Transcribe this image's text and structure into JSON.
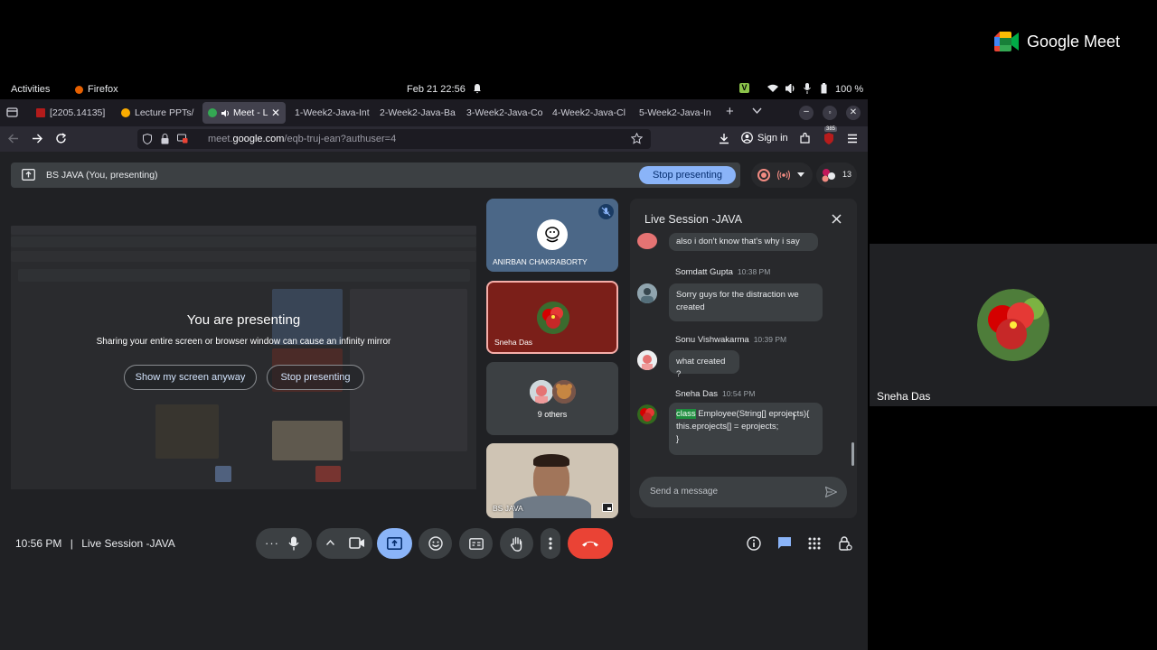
{
  "gnome": {
    "activities": "Activities",
    "app": "Firefox",
    "clock": "Feb 21  22:56",
    "battery": "100 %"
  },
  "tabs": [
    {
      "label": "[2205.14135]",
      "favicon_color": "#b31b1b"
    },
    {
      "label": "Lecture PPTs/",
      "favicon_color": "#f9ab00"
    },
    {
      "label": "Meet - L",
      "favicon_color": "#34a853",
      "active": true
    },
    {
      "label": "1-Week2-Java-Int",
      "favicon_color": ""
    },
    {
      "label": "2-Week2-Java-Ba",
      "favicon_color": ""
    },
    {
      "label": "3-Week2-Java-Co",
      "favicon_color": ""
    },
    {
      "label": "4-Week2-Java-Cl",
      "favicon_color": ""
    },
    {
      "label": "5-Week2-Java-In",
      "favicon_color": ""
    }
  ],
  "browser": {
    "url_prefix": "meet.",
    "url_domain": "google.com",
    "url_path": "/eqb-truj-ean?authuser=4",
    "signin": "Sign in",
    "badge": "385"
  },
  "meet": {
    "present_title": "BS JAVA (You, presenting)",
    "stop_presenting_top": "Stop presenting",
    "participant_count": "13",
    "presenting_heading": "You are presenting",
    "presenting_warning": "Sharing your entire screen or browser window can cause an infinity mirror",
    "show_anyway": "Show my screen anyway",
    "stop_presenting": "Stop presenting",
    "time": "10:56 PM",
    "separator": "|",
    "meeting_name": "Live Session -JAVA"
  },
  "tiles": [
    {
      "name": "ANIRBAN CHAKRABORTY",
      "bg": "#4b6787"
    },
    {
      "name": "Sneha Das",
      "bg": "#7b1f19"
    },
    {
      "name": "9 others",
      "bg": "#3c4043"
    },
    {
      "name": "BS JAVA",
      "bg": "#cfc4b4"
    }
  ],
  "chat": {
    "title": "Live Session -JAVA",
    "input_placeholder": "Send a message",
    "messages": [
      {
        "sender": "",
        "time": "",
        "text": "also i don't know that's why i say"
      },
      {
        "sender": "Somdatt Gupta",
        "time": "10:38 PM",
        "text": "Sorry guys for the distraction we created"
      },
      {
        "sender": "Sonu Vishwakarma",
        "time": "10:39 PM",
        "text": "what created ?"
      },
      {
        "sender": "Sneha Das",
        "time": "10:54 PM",
        "code_keyword": "class",
        "line1": " Employee(String[] eprojects){",
        "line2": "this.eprojects[] = eprojects;",
        "line3": "}"
      }
    ]
  },
  "right": {
    "brand": "Google Meet",
    "self_name": "Sneha Das"
  },
  "colors": {
    "accent_blue": "#8ab4f8",
    "end_call": "#ea4335",
    "highlight": "#1e8e3e"
  }
}
